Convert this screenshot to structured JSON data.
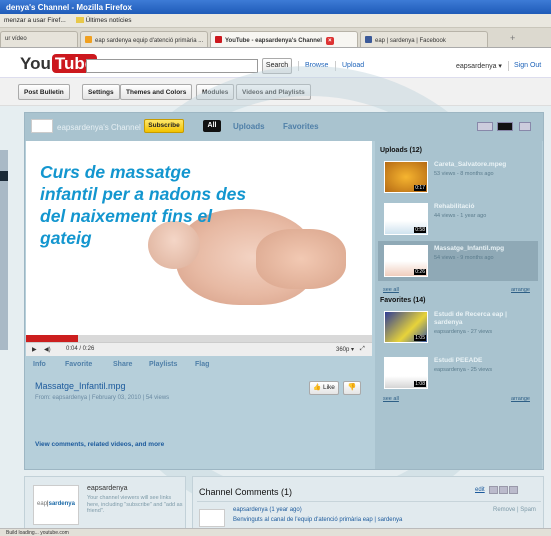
{
  "window": {
    "title": "denya's Channel - Mozilla Firefox"
  },
  "bookmarks": [
    "menzar a usar Firef...",
    "Últimes notícies"
  ],
  "browser_tabs": [
    {
      "label": "ur vídeo",
      "active": false
    },
    {
      "label": "eap sardenya equip d'atenció primària ...",
      "active": false
    },
    {
      "label": "YouTube - eapsardenya's Channel",
      "active": true
    },
    {
      "label": "eap | sardenya | Facebook",
      "active": false
    }
  ],
  "new_tab": "+",
  "youtube": {
    "logo_you": "You",
    "logo_tube": "Tube",
    "search_button": "Search",
    "browse": "Browse",
    "upload": "Upload",
    "account": "eapsardenya ▾",
    "sign_out": "Sign Out"
  },
  "toolbar": [
    "Post Bulletin",
    "Settings",
    "Themes and Colors",
    "Modules",
    "Videos and Playlists"
  ],
  "channel": {
    "name": "eapsardenya's Channel",
    "subscribe": "Subscribe",
    "tab_all": "All",
    "tab_uploads": "Uploads",
    "tab_favorites": "Favorites"
  },
  "player": {
    "slide_title": "Curs de massatge infantil per a nadons des del naixement fins el gateig",
    "time": "0:04 / 0:26",
    "quality": "360p ▾",
    "progress": 0.15
  },
  "info_tabs": [
    "Info",
    "Favorite",
    "Share",
    "Playlists",
    "Flag"
  ],
  "video": {
    "title": "Massatge_Infantil.mpg",
    "meta": "From: eapsardenya | February 03, 2010 | 54 views",
    "like": "Like",
    "view_comments": "View comments, related videos, and more"
  },
  "uploads": {
    "heading": "Uploads (12)",
    "items": [
      {
        "title": "Careta_Salvatore.mpeg",
        "meta": "53 views - 8 months ago",
        "duration": "0:17",
        "selected": false
      },
      {
        "title": "Rehabilitació",
        "meta": "44 views - 1 year ago",
        "duration": "0:58",
        "selected": false
      },
      {
        "title": "Massatge_Infantil.mpg",
        "meta": "54 views - 9 months ago",
        "duration": "0:26",
        "selected": true
      }
    ],
    "see_all": "see all",
    "arrange": "arrange"
  },
  "favorites": {
    "heading": "Favorites (14)",
    "items": [
      {
        "title": "Estudi de Recerca eap | sardenya",
        "meta": "eapsardenya - 27 views",
        "duration": "1:05"
      },
      {
        "title": "Estudi PEEADE",
        "meta": "eapsardenya - 25 views",
        "duration": "1:08"
      }
    ],
    "see_all": "see all",
    "arrange": "arrange"
  },
  "profile": {
    "logo_eap": "eap",
    "logo_sardenya": "sardenya",
    "name": "eapsardenya",
    "note": "Your channel viewers will see links here, including \"subscribe\" and \"add as friend\"."
  },
  "comments": {
    "title": "Channel Comments (1)",
    "edit": "edit",
    "author": "eapsardenya (1 year ago)",
    "actions": "Remove | Spam",
    "text": "Benvinguts al canal de l'equip d'atenció primària eap | sardenya"
  },
  "status": "Build loading... youtube.com"
}
